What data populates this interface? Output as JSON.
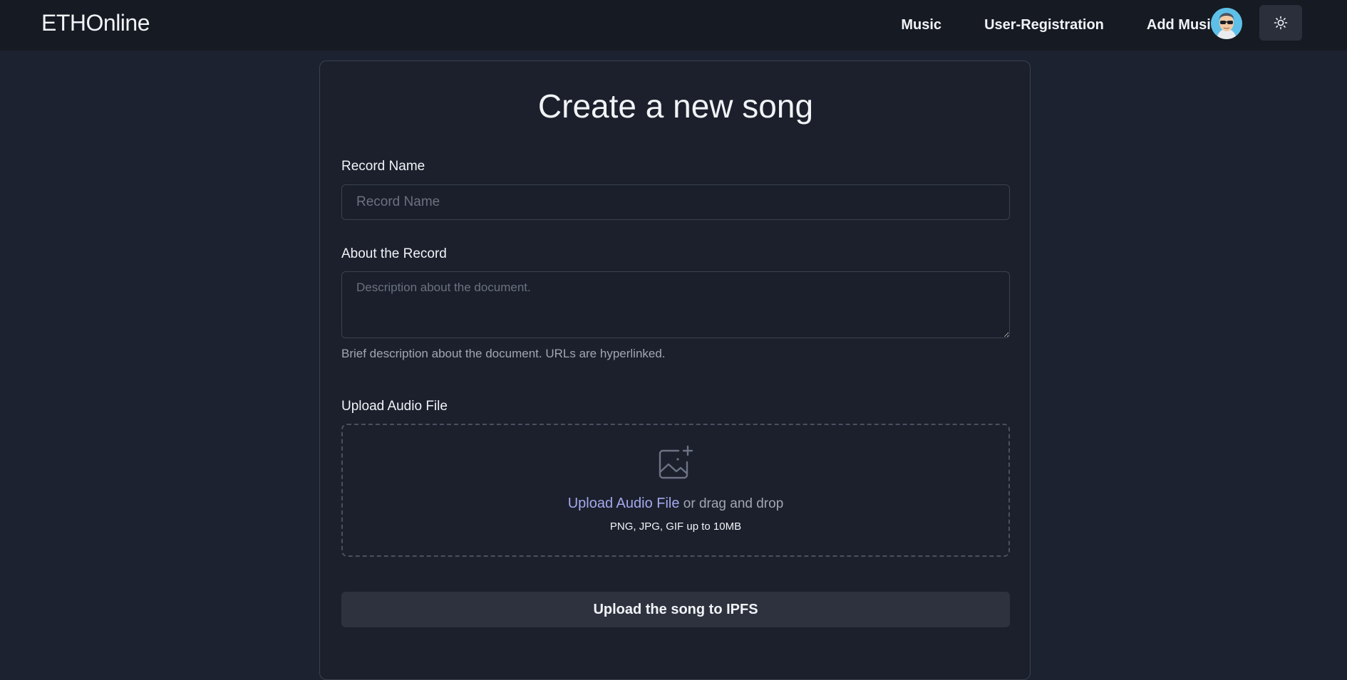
{
  "navbar": {
    "brand": "ETHOnline",
    "links": [
      "Music",
      "User-Registration",
      "Add Music"
    ],
    "avatar_icon": "avatar-sunglasses-icon",
    "theme_icon": "sun-icon"
  },
  "form": {
    "title": "Create a new song",
    "record_name": {
      "label": "Record Name",
      "placeholder": "Record Name",
      "value": ""
    },
    "about": {
      "label": "About the Record",
      "placeholder": "Description about the document.",
      "value": "",
      "help": "Brief description about the document. URLs are hyperlinked."
    },
    "upload": {
      "label": "Upload Audio File",
      "link_text": "Upload Audio File",
      "drag_text": " or drag and drop",
      "hint": "PNG, JPG, GIF up to 10MB",
      "icon": "image-add-icon"
    },
    "submit_label": "Upload the song to IPFS"
  },
  "colors": {
    "background": "#1d2230",
    "navbar": "#161a23",
    "link_accent": "#a5a8ec",
    "button": "#2d323e"
  }
}
